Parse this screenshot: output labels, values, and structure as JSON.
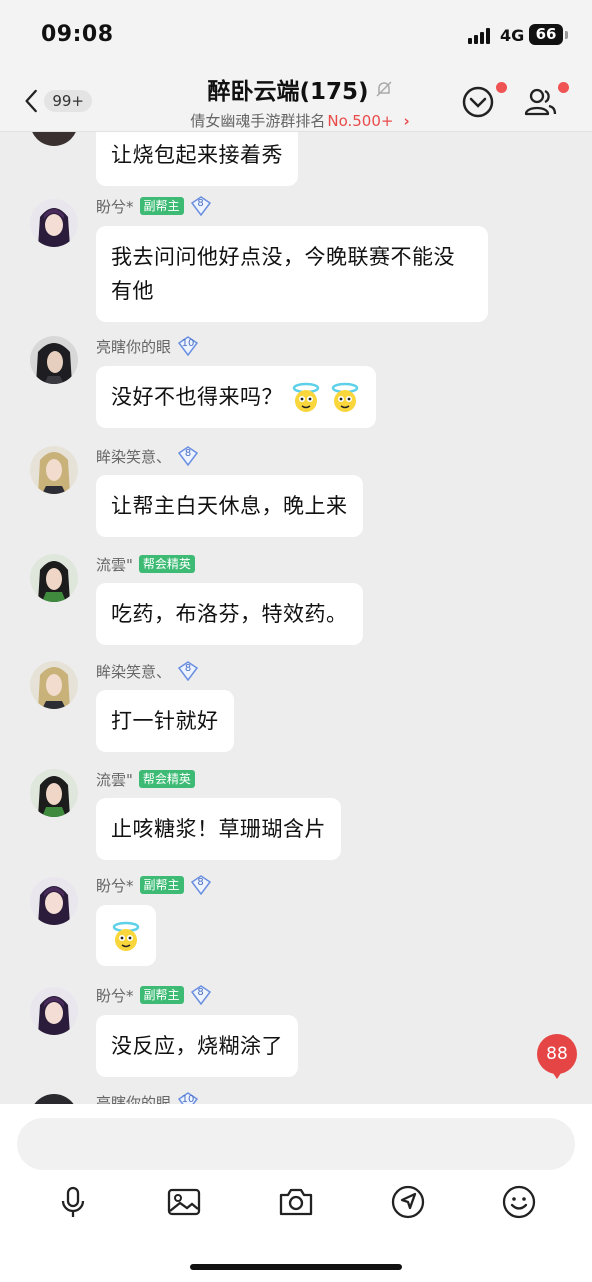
{
  "status_bar": {
    "time": "09:08",
    "network": "4G",
    "battery": "66"
  },
  "header": {
    "back_badge": "99+",
    "title": "醉卧云端(175)",
    "subtitle_prefix": "倩女幽魂手游群排名",
    "rank": "No.500+"
  },
  "messages": [
    {
      "sender": "",
      "role": "",
      "level": "",
      "text": "让烧包起来接着秀",
      "emojis": 0
    },
    {
      "sender": "盼兮*",
      "role": "副帮主",
      "level": "8",
      "text": "我去问问他好点没，今晚联赛不能没有他",
      "emojis": 0
    },
    {
      "sender": "亮瞎你的眼",
      "role": "",
      "level": "10",
      "text": "没好不也得来吗？",
      "emojis": 2
    },
    {
      "sender": "眸染笑意、",
      "role": "",
      "level": "8",
      "text": "让帮主白天休息，晚上来",
      "emojis": 0
    },
    {
      "sender": "流雲\"",
      "role": "帮会精英",
      "level": "",
      "text": "吃药，布洛芬，特效药。",
      "emojis": 0
    },
    {
      "sender": "眸染笑意、",
      "role": "",
      "level": "8",
      "text": "打一针就好",
      "emojis": 0
    },
    {
      "sender": "流雲\"",
      "role": "帮会精英",
      "level": "",
      "text": "止咳糖浆！草珊瑚含片",
      "emojis": 0
    },
    {
      "sender": "盼兮*",
      "role": "副帮主",
      "level": "8",
      "text": "",
      "emojis": 1
    },
    {
      "sender": "盼兮*",
      "role": "副帮主",
      "level": "8",
      "text": "没反应，烧糊涂了",
      "emojis": 0
    },
    {
      "sender": "亮瞎你的眼",
      "role": "",
      "level": "10",
      "text": "",
      "emojis": 0
    }
  ],
  "new_message_count": "88",
  "input": {
    "placeholder": ""
  },
  "toolbar": [
    "mic-icon",
    "image-icon",
    "camera-icon",
    "location-icon",
    "emoji-icon"
  ],
  "colors": {
    "role_badge": "#3dbb74",
    "rank": "#e94b4b",
    "unread_badge": "#e64545",
    "background": "#ededed"
  }
}
